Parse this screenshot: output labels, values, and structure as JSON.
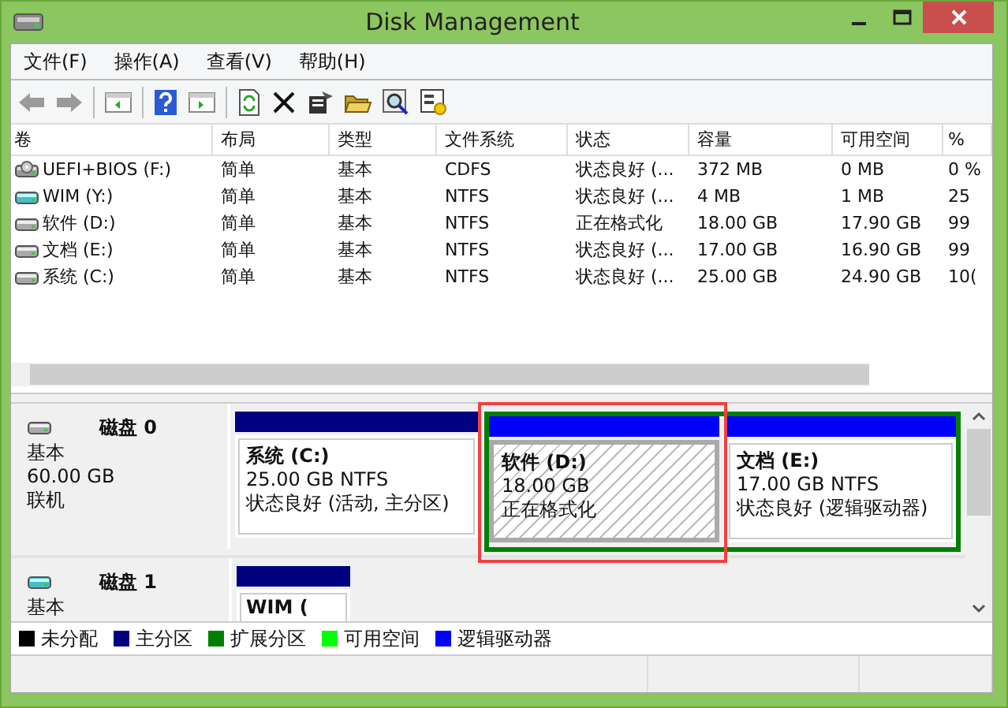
{
  "window": {
    "title": "Disk Management"
  },
  "menu": [
    "文件(F)",
    "操作(A)",
    "查看(V)",
    "帮助(H)"
  ],
  "table": {
    "columns": [
      "卷",
      "布局",
      "类型",
      "文件系统",
      "状态",
      "容量",
      "可用空间",
      "%"
    ],
    "rows": [
      {
        "kind": "optical",
        "cells": [
          "UEFI+BIOS (F:)",
          "简单",
          "基本",
          "CDFS",
          "状态良好 (...",
          "372 MB",
          "0 MB",
          "0 %"
        ]
      },
      {
        "kind": "removable",
        "cells": [
          "WIM (Y:)",
          "简单",
          "基本",
          "NTFS",
          "状态良好 (...",
          "4 MB",
          "1 MB",
          "25"
        ]
      },
      {
        "kind": "disk",
        "cells": [
          "软件 (D:)",
          "简单",
          "基本",
          "NTFS",
          "正在格式化",
          "18.00 GB",
          "17.90 GB",
          "99"
        ]
      },
      {
        "kind": "disk",
        "cells": [
          "文档 (E:)",
          "简单",
          "基本",
          "NTFS",
          "状态良好 (...",
          "17.00 GB",
          "16.90 GB",
          "99"
        ]
      },
      {
        "kind": "disk",
        "cells": [
          "系统 (C:)",
          "简单",
          "基本",
          "NTFS",
          "状态良好 (...",
          "25.00 GB",
          "24.90 GB",
          "10("
        ]
      }
    ]
  },
  "disks": [
    {
      "kind": "disk",
      "name": "磁盘 0",
      "type": "基本",
      "size": "60.00 GB",
      "status": "联机",
      "partitions": [
        {
          "kind": "primary",
          "name": "系统  (C:)",
          "detail": "25.00 GB NTFS",
          "status": "状态良好 (活动, 主分区)",
          "formatting": false,
          "highlighted": false
        },
        {
          "kind": "extended",
          "children": [
            {
              "kind": "logical",
              "name": "软件  (D:)",
              "detail": "18.00 GB",
              "status": "正在格式化",
              "formatting": true,
              "highlighted": true
            },
            {
              "kind": "logical",
              "name": "文档  (E:)",
              "detail": "17.00 GB NTFS",
              "status": "状态良好 (逻辑驱动器)",
              "formatting": false,
              "highlighted": false
            }
          ]
        }
      ]
    },
    {
      "kind": "removable",
      "name": "磁盘 1",
      "type": "基本",
      "partitions": [
        {
          "kind": "primary",
          "name": "WIM  (",
          "formatting": false,
          "highlighted": false
        }
      ]
    }
  ],
  "legend": [
    {
      "label": "未分配",
      "color": "#000000"
    },
    {
      "label": "主分区",
      "color": "#000080"
    },
    {
      "label": "扩展分区",
      "color": "#008000"
    },
    {
      "label": "可用空间",
      "color": "#00ff00"
    },
    {
      "label": "逻辑驱动器",
      "color": "#0000ff"
    }
  ]
}
